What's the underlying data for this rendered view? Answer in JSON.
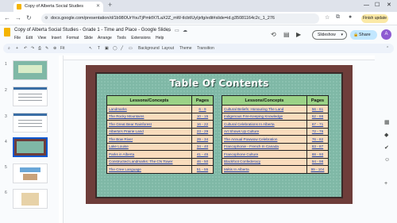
{
  "browser": {
    "tab_title": "Copy of Alberta Social Studies",
    "url": "docs.google.com/presentation/d/1b98OUrYouTjPmkfX7LaX2Z_mW-tlcbtIUyIjxfg/edit#slide=id.g35081164c2c_1_276",
    "finish_update": "Finish update"
  },
  "docs": {
    "title": "Copy of Alberta Social Studies - Grade 1 - Time and Place - Google Slides",
    "menu": [
      "File",
      "Edit",
      "View",
      "Insert",
      "Format",
      "Slide",
      "Arrange",
      "Tools",
      "Extensions",
      "Help"
    ],
    "slideshow_label": "Slideshow",
    "share_label": "Share",
    "avatar_letter": "A"
  },
  "toolbar": {
    "zoom": "Fit",
    "background": "Background",
    "layout": "Layout",
    "theme": "Theme",
    "transition": "Transition"
  },
  "filmstrip": {
    "slide_numbers": [
      "1",
      "2",
      "3",
      "4",
      "5",
      "6"
    ],
    "selected": "4"
  },
  "slide": {
    "title": "Table Of Contents",
    "left_header": [
      "Lessons/Concepts",
      "Pages"
    ],
    "left_rows": [
      [
        "Landmarks",
        "6 - 9"
      ],
      [
        "The Rocky Mountains",
        "10 - 15"
      ],
      [
        "The Great Bear Rainforest",
        "16 - 22"
      ],
      [
        "Alberta's Prairie Land",
        "23 - 29"
      ],
      [
        "The Bow River",
        "29 - 34"
      ],
      [
        "Lake Louise",
        "34 - 40"
      ],
      [
        "Parks in Alberta",
        "41 - 45"
      ],
      [
        "Constructed Landmarks: The CN Tower",
        "46 - 50"
      ],
      [
        "The Cree Language",
        "51 - 55"
      ]
    ],
    "right_header": [
      "Lessons/Concepts",
      "Pages"
    ],
    "right_rows": [
      [
        "Cultural Beliefs: Honouring The Land",
        "56 - 61"
      ],
      [
        "Indigenous Fire-Keeping Knowledge",
        "62 - 66"
      ],
      [
        "Cultural Celebrations In Alberta",
        "67 - 71"
      ],
      [
        "Art Shows Up Culture",
        "72 - 76"
      ],
      [
        "The Annual Powwow Celebration",
        "76 - 82"
      ],
      [
        "Francophonie - French In Canada",
        "83 - 87"
      ],
      [
        "Francophone Culture",
        "88 - 93"
      ],
      [
        "Blackfoot Confederacy",
        "94 - 98"
      ],
      [
        "Métis In Alberta",
        "99 - 104"
      ]
    ]
  }
}
